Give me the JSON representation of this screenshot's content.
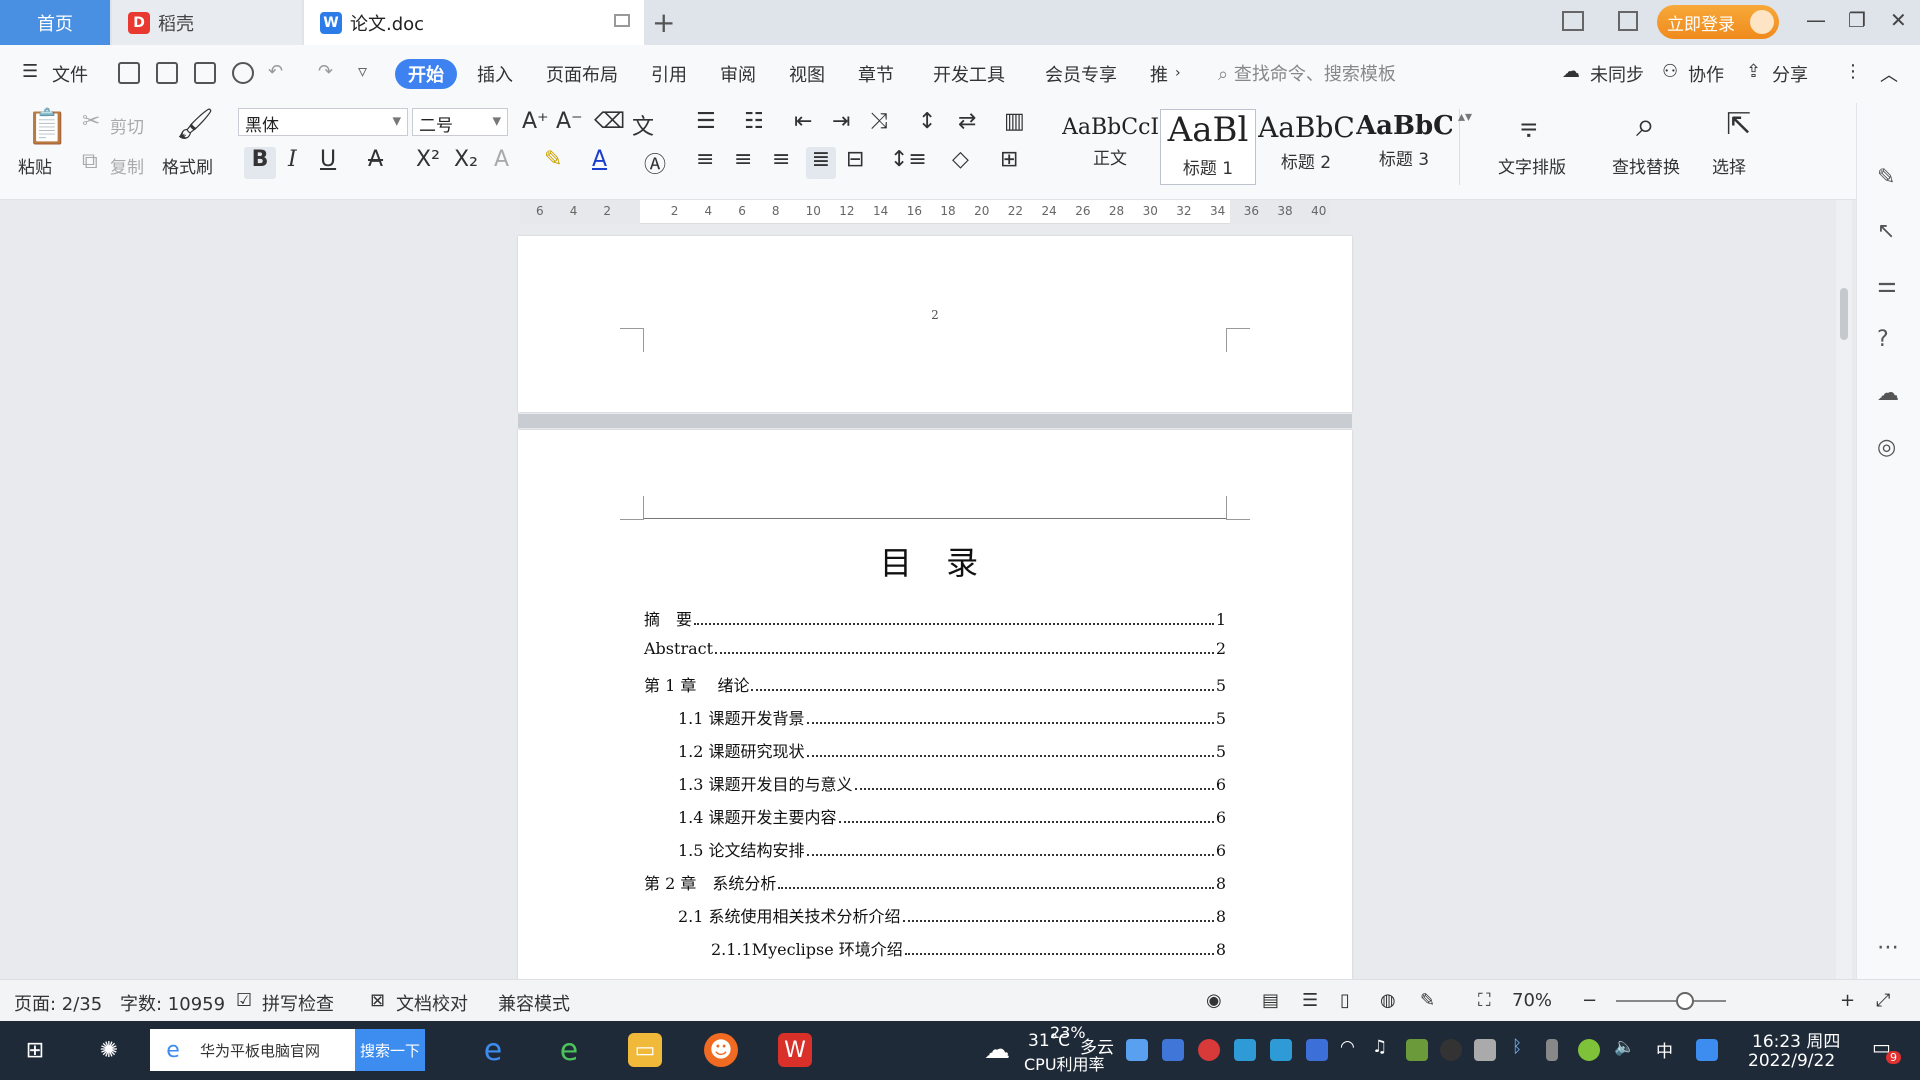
{
  "tabs": {
    "home": "首页",
    "daoke": "稻壳",
    "doc": "论文.doc"
  },
  "login": "立即登录",
  "menu": {
    "file": "文件",
    "items": [
      "开始",
      "插入",
      "页面布局",
      "引用",
      "审阅",
      "视图",
      "章节",
      "开发工具",
      "会员专享",
      "推"
    ],
    "search_placeholder": "查找命令、搜索模板",
    "unsync": "未同步",
    "collab": "协作",
    "share": "分享"
  },
  "ribbon": {
    "paste": "粘贴",
    "cut": "剪切",
    "copy": "复制",
    "format_painter": "格式刷",
    "font_name": "黑体",
    "font_size": "二号",
    "styles": [
      {
        "preview": "AaBbCcI",
        "name": "正文"
      },
      {
        "preview": "AaBl",
        "name": "标题 1"
      },
      {
        "preview": "AaBbC",
        "name": "标题 2"
      },
      {
        "preview": "AaBbC",
        "name": "标题 3"
      }
    ],
    "text_layout": "文字排版",
    "find_replace": "查找替换",
    "select": "选择"
  },
  "ruler_marks": [
    "6",
    "4",
    "2",
    "",
    "2",
    "4",
    "6",
    "8",
    "10",
    "12",
    "14",
    "16",
    "18",
    "20",
    "22",
    "24",
    "26",
    "28",
    "30",
    "32",
    "34",
    "36",
    "38",
    "40"
  ],
  "document": {
    "page1_number": "2",
    "toc_title": "目 录",
    "toc": [
      {
        "text": "摘　要",
        "page": "1",
        "level": 0
      },
      {
        "text": "Abstract",
        "page": "2",
        "level": 0
      },
      {
        "text": "第 1 章　 绪论",
        "page": "5",
        "level": 0
      },
      {
        "text": "1.1 课题开发背景",
        "page": "5",
        "level": 1
      },
      {
        "text": "1.2 课题研究现状",
        "page": "5",
        "level": 1
      },
      {
        "text": "1.3 课题开发目的与意义",
        "page": "6",
        "level": 1
      },
      {
        "text": "1.4 课题开发主要内容",
        "page": "6",
        "level": 1
      },
      {
        "text": "1.5 论文结构安排",
        "page": "6",
        "level": 1
      },
      {
        "text": "第 2 章　系统分析",
        "page": "8",
        "level": 0
      },
      {
        "text": "2.1 系统使用相关技术分析介绍",
        "page": "8",
        "level": 1
      },
      {
        "text": "2.1.1Myeclipse 环境介绍",
        "page": "8",
        "level": 2
      }
    ]
  },
  "status": {
    "page": "页面: 2/35",
    "words": "字数: 10959",
    "spell": "拼写检查",
    "proof": "文档校对",
    "compat": "兼容模式",
    "zoom": "70%"
  },
  "taskbar": {
    "search_text": "华为平板电脑官网",
    "search_btn": "搜索一下",
    "weather_temp": "31°C",
    "weather_desc": "多云",
    "cpu_pct": "23%",
    "cpu_label": "CPU利用率",
    "ime": "中",
    "time": "16:23 周四",
    "date": "2022/9/22",
    "notif_count": "9"
  }
}
